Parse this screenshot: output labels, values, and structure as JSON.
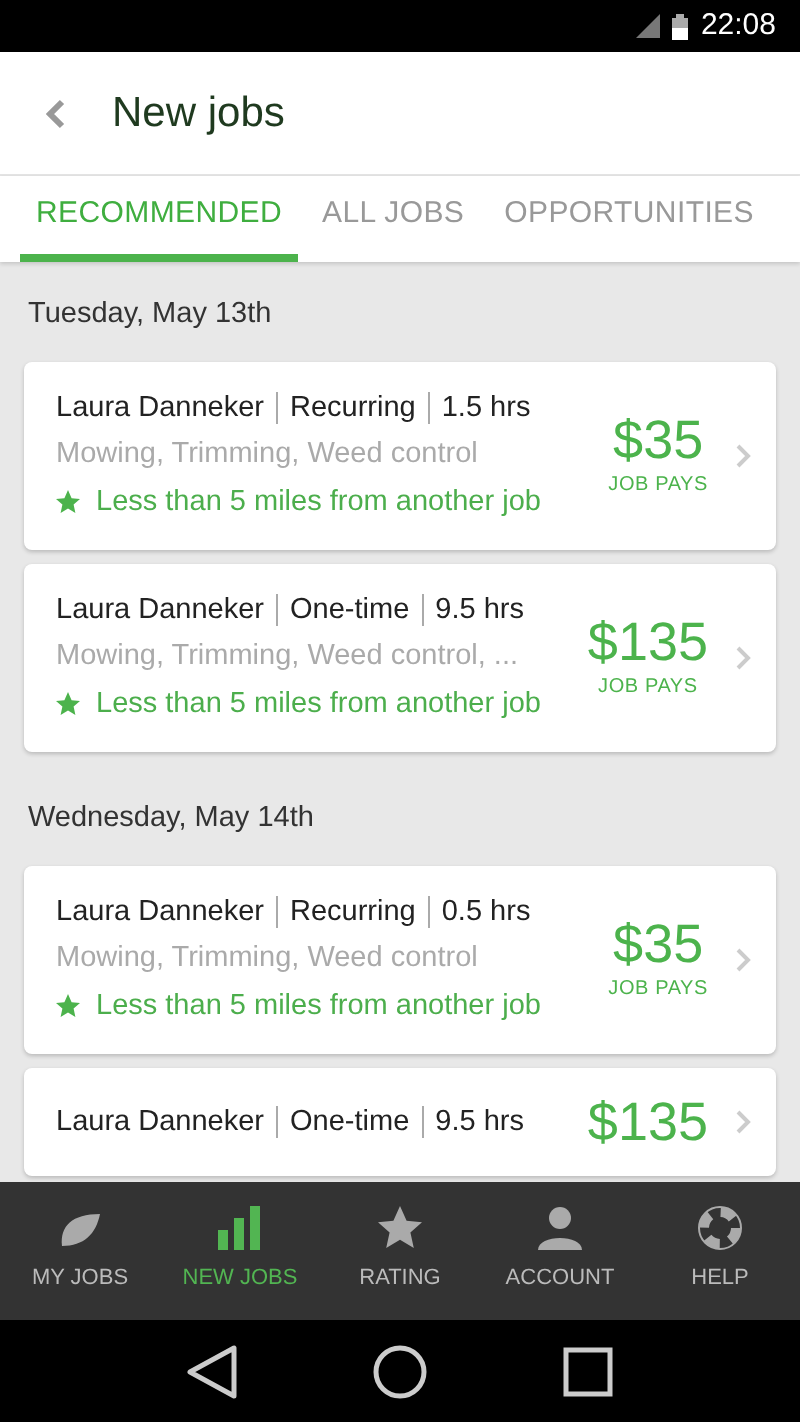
{
  "status_bar": {
    "time": "22:08"
  },
  "header": {
    "title": "New jobs"
  },
  "tabs": [
    {
      "label": "RECOMMENDED",
      "selected": true
    },
    {
      "label": "ALL JOBS",
      "selected": false
    },
    {
      "label": "OPPORTUNITIES",
      "selected": false
    }
  ],
  "days": [
    {
      "date": "Tuesday, May 13th",
      "jobs": [
        {
          "client": "Laura Danneker",
          "type": "Recurring",
          "hours": "1.5 hrs",
          "services": "Mowing, Trimming, Weed control",
          "note": "Less than 5 miles from another job",
          "price": "$35",
          "price_label": "JOB PAYS"
        },
        {
          "client": "Laura Danneker",
          "type": "One-time",
          "hours": "9.5 hrs",
          "services": "Mowing, Trimming, Weed control, ...",
          "note": "Less than 5 miles from another job",
          "price": "$135",
          "price_label": "JOB PAYS"
        }
      ]
    },
    {
      "date": "Wednesday, May 14th",
      "jobs": [
        {
          "client": "Laura Danneker",
          "type": "Recurring",
          "hours": "0.5 hrs",
          "services": "Mowing, Trimming, Weed control",
          "note": "Less than 5 miles from another job",
          "price": "$35",
          "price_label": "JOB PAYS"
        },
        {
          "client": "Laura Danneker",
          "type": "One-time",
          "hours": "9.5 hrs",
          "price": "$135"
        }
      ]
    }
  ],
  "bottom_nav": [
    {
      "label": "MY JOBS",
      "kind": "leaf",
      "selected": false
    },
    {
      "label": "NEW JOBS",
      "kind": "bars",
      "selected": true
    },
    {
      "label": "RATING",
      "kind": "star",
      "selected": false
    },
    {
      "label": "ACCOUNT",
      "kind": "person",
      "selected": false
    },
    {
      "label": "HELP",
      "kind": "lifebuoy",
      "selected": false
    }
  ]
}
